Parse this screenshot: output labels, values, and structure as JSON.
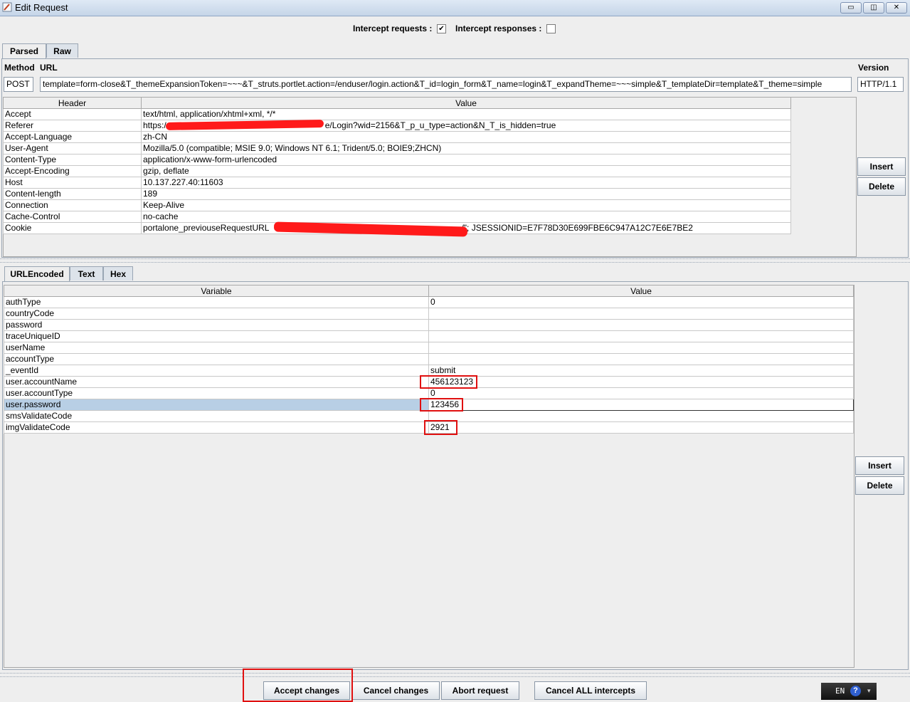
{
  "window": {
    "title": "Edit Request",
    "controls": {
      "minimize": "▭",
      "maximize": "◫",
      "close": "✕"
    }
  },
  "intercept": {
    "requests_label": "Intercept requests :",
    "requests_checked": "✔",
    "responses_label": "Intercept responses :",
    "responses_checked": ""
  },
  "request_tabs": [
    "Parsed",
    "Raw"
  ],
  "request_line": {
    "method_label": "Method",
    "url_label": "URL",
    "version_label": "Version",
    "method": "POST",
    "url": "template=form-close&T_themeExpansionToken=~~~&T_struts.portlet.action=/enduser/login.action&T_id=login_form&T_name=login&T_expandTheme=~~~simple&T_templateDir=template&T_theme=simple",
    "version": "HTTP/1.1"
  },
  "headers_table": {
    "columns": [
      "Header",
      "Value"
    ],
    "rows": [
      [
        "Accept",
        "text/html, application/xhtml+xml, */*"
      ],
      [
        "Referer",
        "https:/",
        "e/Login?wid=2156&T_p_u_type=action&N_T_is_hidden=true"
      ],
      [
        "Accept-Language",
        "zh-CN"
      ],
      [
        "User-Agent",
        "Mozilla/5.0 (compatible; MSIE 9.0; Windows NT 6.1; Trident/5.0; BOIE9;ZHCN)"
      ],
      [
        "Content-Type",
        "application/x-www-form-urlencoded"
      ],
      [
        "Accept-Encoding",
        "gzip, deflate"
      ],
      [
        "Host",
        "10.137.227.40:11603"
      ],
      [
        "Content-length",
        "189"
      ],
      [
        "Connection",
        "Keep-Alive"
      ],
      [
        "Cache-Control",
        "no-cache"
      ],
      [
        "Cookie",
        "portalone_previouseRequestURL",
        "/\"; JSESSIONID=E7F78D30E699FBE6C947A12C7E6E7BE2"
      ]
    ]
  },
  "header_buttons": {
    "insert": "Insert",
    "delete": "Delete"
  },
  "body_tabs": [
    "URLEncoded",
    "Text",
    "Hex"
  ],
  "params_table": {
    "columns": [
      "Variable",
      "Value"
    ],
    "rows": [
      [
        "authType",
        "0"
      ],
      [
        "countryCode",
        ""
      ],
      [
        "password",
        ""
      ],
      [
        "traceUniqueID",
        ""
      ],
      [
        "userName",
        ""
      ],
      [
        "accountType",
        ""
      ],
      [
        "_eventId",
        "submit"
      ],
      [
        "user.accountName",
        "456123123"
      ],
      [
        "user.accountType",
        "0"
      ],
      [
        "user.password",
        "123456"
      ],
      [
        "smsValidateCode",
        ""
      ],
      [
        "imgValidateCode",
        "2921"
      ]
    ],
    "selected_row": "user.password"
  },
  "param_buttons": {
    "insert": "Insert",
    "delete": "Delete"
  },
  "footer_buttons": {
    "accept": "Accept changes",
    "cancel": "Cancel changes",
    "abort": "Abort request",
    "cancel_all": "Cancel ALL intercepts"
  },
  "ime": {
    "lang": "EN",
    "help": "?"
  },
  "colors": {
    "highlight_red": "#e01010",
    "selection": "#b8cfe5",
    "redaction": "#ff1a1a"
  }
}
